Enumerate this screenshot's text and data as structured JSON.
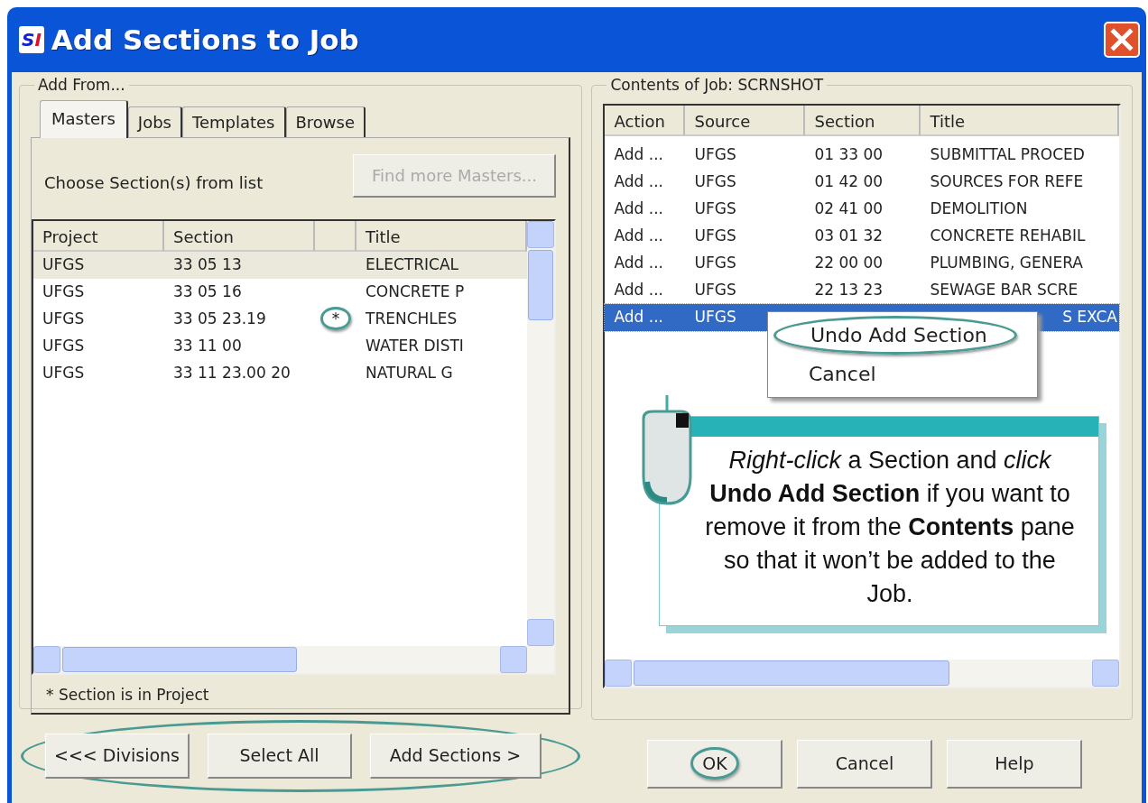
{
  "window": {
    "app_icon": "SI",
    "title": "Add Sections to Job"
  },
  "add_from": {
    "label": "Add From...",
    "tabs": [
      {
        "label": "Masters",
        "selected": true
      },
      {
        "label": "Jobs",
        "selected": false
      },
      {
        "label": "Templates",
        "selected": false
      },
      {
        "label": "Browse",
        "selected": false
      }
    ],
    "instruction": "Choose Section(s) from list",
    "find_button": {
      "label": "Find more Masters...",
      "disabled": true
    },
    "columns": [
      "Project",
      "Section",
      "Title"
    ],
    "rows": [
      {
        "project": "UFGS",
        "section": "33 05 13",
        "title": "ELECTRICAL",
        "selected": true
      },
      {
        "project": "UFGS",
        "section": "33 05 16",
        "title": "CONCRETE P",
        "selected": false
      },
      {
        "project": "UFGS",
        "section": "33 05 23.19",
        "marker": "*",
        "marker_circled": true,
        "title": "TRENCHLES",
        "selected": false
      },
      {
        "project": "UFGS",
        "section": "33 11 00",
        "title": "WATER DISTI",
        "selected": false
      },
      {
        "project": "UFGS",
        "section": "33 11 23.00 20",
        "title": "NATURAL G",
        "selected": false
      }
    ],
    "footnote": "* Section is in Project"
  },
  "left_buttons": {
    "circled": true,
    "items": [
      "<<< Divisions",
      "Select All",
      "Add Sections >"
    ]
  },
  "contents": {
    "label": "Contents of Job: SCRNSHOT",
    "columns": [
      "Action",
      "Source",
      "Section",
      "Title"
    ],
    "rows": [
      {
        "action": "Add ...",
        "source": "UFGS",
        "section": "01 33 00",
        "title": "SUBMITTAL PROCED",
        "selected": false
      },
      {
        "action": "Add ...",
        "source": "UFGS",
        "section": "01 42 00",
        "title": "SOURCES FOR REFE",
        "selected": false
      },
      {
        "action": "Add ...",
        "source": "UFGS",
        "section": "02 41 00",
        "title": "DEMOLITION",
        "selected": false
      },
      {
        "action": "Add ...",
        "source": "UFGS",
        "section": "03 01 32",
        "title": "CONCRETE REHABIL",
        "selected": false
      },
      {
        "action": "Add ...",
        "source": "UFGS",
        "section": "22 00 00",
        "title": "PLUMBING, GENERA",
        "selected": false
      },
      {
        "action": "Add ...",
        "source": "UFGS",
        "section": "22 13 23",
        "title": "SEWAGE BAR SCRE",
        "selected": false
      },
      {
        "action": "Add ...",
        "source": "UFGS",
        "title": "S EXCA",
        "selected": true
      }
    ]
  },
  "context_menu": [
    {
      "label": "Undo Add Section",
      "circled": true
    },
    {
      "label": "Cancel",
      "circled": false
    }
  ],
  "callout": {
    "text": "*Right-click* a Section and *click* **Undo Add Section** if you want to remove it from the **Contents** pane so that it won’t be added to the Job."
  },
  "right_buttons": [
    {
      "label": "OK",
      "circled": true
    },
    {
      "label": "Cancel",
      "circled": false
    },
    {
      "label": "Help",
      "circled": false
    }
  ]
}
